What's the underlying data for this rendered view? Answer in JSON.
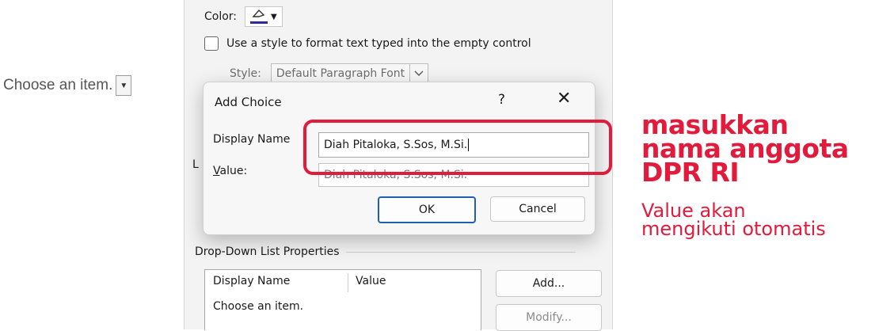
{
  "panel": {
    "color_label": "Color:",
    "style_checkbox_label": "Use a style to format text typed into the empty control",
    "style_label": "Style:",
    "style_value": "Default Paragraph Font",
    "stray_label": "L",
    "dropdown_section_title": "Drop-Down List Properties",
    "list_columns": [
      "Display Name",
      "Value"
    ],
    "list_rows": [
      [
        "Choose an item.",
        ""
      ]
    ],
    "add_button": "Add...",
    "modify_button": "Modify..."
  },
  "content_control": {
    "text": "Choose an item."
  },
  "dialog": {
    "title": "Add Choice",
    "help": "?",
    "close": "✕",
    "display_name_label": "Display Name",
    "display_name_value": "Diah Pitaloka, S.Sos, M.Si.",
    "value_label": "Value:",
    "value_value": "Diah Pitaloka, S.Sos, M.Si.",
    "ok_button": "OK",
    "cancel_button": "Cancel"
  },
  "annotation": {
    "title_lines": [
      "masukkan",
      "nama anggota",
      "DPR RI"
    ],
    "subtitle_lines": [
      "Value akan",
      "mengikuti otomatis"
    ],
    "color": "#e21b3c"
  }
}
